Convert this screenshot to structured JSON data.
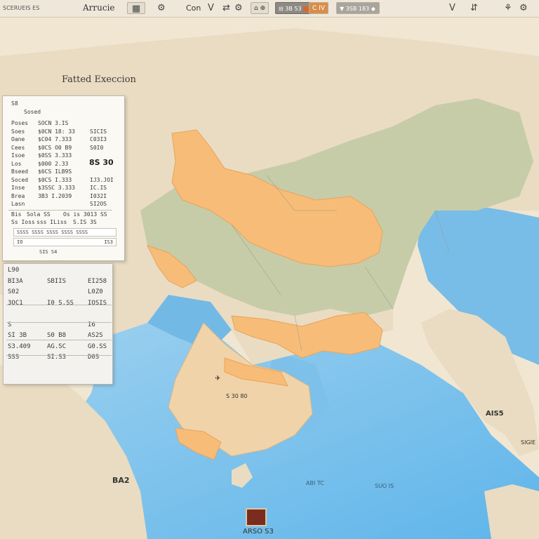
{
  "toolbar": {
    "left_text": "SCERUEIS ES",
    "title": "Arrucie",
    "grid_icon": "grid-icon",
    "btn_gear": "⚙",
    "btn_con": "Con",
    "btn_v": "V",
    "btn_swap": "⇄",
    "btn_tools": "⚙",
    "btn_layers": "⌂ ⊕",
    "dark_btn": "⊟ 3B 53",
    "orange_btn": "C",
    "orange_btn_right": "IV",
    "search_text": "▼ 3SB 183 ◆",
    "right_v": "V",
    "right_share": "⇵",
    "right_person": "⚘",
    "right_settings": "⚙"
  },
  "map_title": "Fatted Execcion",
  "panel1": {
    "header": "S8",
    "subheader": "Sosed",
    "rows": [
      {
        "label": "Poses",
        "mid": "SOCN   3.IS",
        "right": ""
      },
      {
        "label": "Soes",
        "mid": "$0CN  18:  33",
        "right": "SICIS"
      },
      {
        "label": "Oane",
        "mid": "$C04  7.333",
        "right": "C03I3"
      },
      {
        "label": "Cees",
        "mid": "$0CS  O0 B9",
        "right": "S0I0"
      },
      {
        "label": "Isoe",
        "mid": "$0SS  3.333",
        "right": ""
      },
      {
        "label": "Los",
        "mid": "$000  2.33",
        "right": ""
      },
      {
        "label": "Bseed",
        "mid": "$6CS  ILB9S",
        "right": ""
      },
      {
        "label": "Soced",
        "mid": "$0CS  I.333",
        "right": "IJ3.JOI"
      },
      {
        "label": "Inse",
        "mid": "$3SSC  3.333",
        "right": "IC.IS"
      },
      {
        "label": "Brea",
        "mid": "3B3  I.2039",
        "right": "I032I"
      },
      {
        "label": "Lasn",
        "mid": "",
        "right": "SI2OS"
      }
    ],
    "big_value": "8S 30",
    "footer1": {
      "label": "Bis",
      "mid": "Sola SS",
      "right": "Os is 3013 SS"
    },
    "footer2": {
      "label": "Ss  Ioss",
      "mid": "sss   ILiss",
      "right": "S.IS 3S"
    },
    "box1_text": "SSSS SSSS SSSS SSSS SSSS",
    "box2_left": "IO",
    "box2_right": "IS3",
    "box3_text": "SIS S4"
  },
  "panel2": {
    "rows": [
      {
        "label": "L90",
        "mid": "",
        "right": ""
      },
      {
        "label": "BI3A",
        "mid": "SBIIS",
        "right": "EI258"
      },
      {
        "label": "S02",
        "mid": "",
        "right": "L0Z0"
      },
      {
        "label": "3OC1",
        "mid": "I0  S.SS",
        "right": "IOSIS"
      },
      {
        "label": "",
        "mid": "",
        "right": ""
      },
      {
        "label": "S",
        "mid": "",
        "right": "I6"
      },
      {
        "label": "SI 3B",
        "mid": "S0 B8",
        "right": "AS2S"
      },
      {
        "label": "S3.409",
        "mid": "AG.SC",
        "right": "G0.SS"
      },
      {
        "label": "SSS",
        "mid": "SI.S3",
        "right": "D0S"
      }
    ]
  },
  "map_labels": {
    "gulf": "✈",
    "arabia_code": "S  30 80",
    "east_asia": "AIS5",
    "india_sw": "BA2",
    "south_ocean": "ABI TC",
    "southeast": "SUO IS",
    "pacific": "SIGIE",
    "bottom_marker_text": "ARSO S3"
  },
  "colors": {
    "ocean": "#7cc0ea",
    "land": "#e8d7ba",
    "highlight": "#f7bd7a",
    "green_region": "#c8ceaa",
    "panel_bg": "#fbf9f4"
  }
}
